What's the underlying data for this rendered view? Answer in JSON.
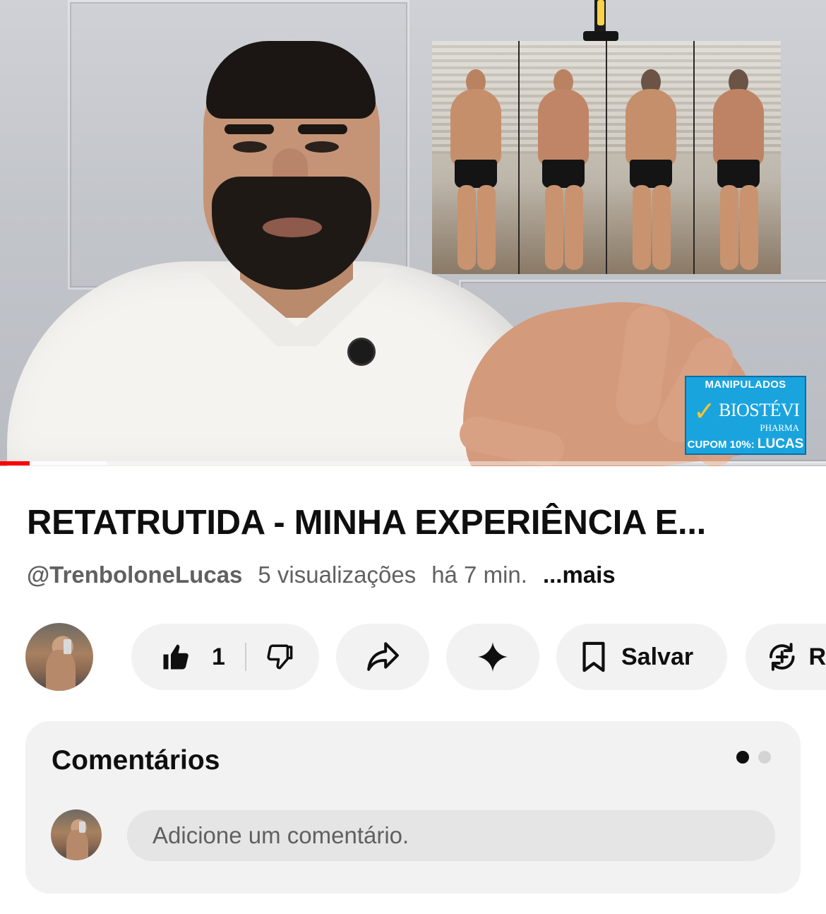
{
  "video": {
    "sponsor": {
      "top_text": "MANIPULADOS",
      "brand": "BIOSTÉVI",
      "sub": "PHARMA",
      "coupon_prefix": "CUPOM 10%:",
      "coupon_code": "LUCAS"
    },
    "progress_percent": 3.6,
    "buffered_percent": 13
  },
  "title": "RETATRUTIDA - MINHA EXPERIÊNCIA E...",
  "meta": {
    "channel": "@TrenboloneLucas",
    "views": "5 visualizações",
    "time": "há 7 min.",
    "more": "...mais"
  },
  "actions": {
    "like_count": "1",
    "save_label": "Salvar",
    "remix_label": "R"
  },
  "comments": {
    "title": "Comentários",
    "placeholder": "Adicione um comentário."
  },
  "colors": {
    "progress": "#ff0000",
    "pill_bg": "#f2f2f2",
    "meta_text": "#606060"
  }
}
